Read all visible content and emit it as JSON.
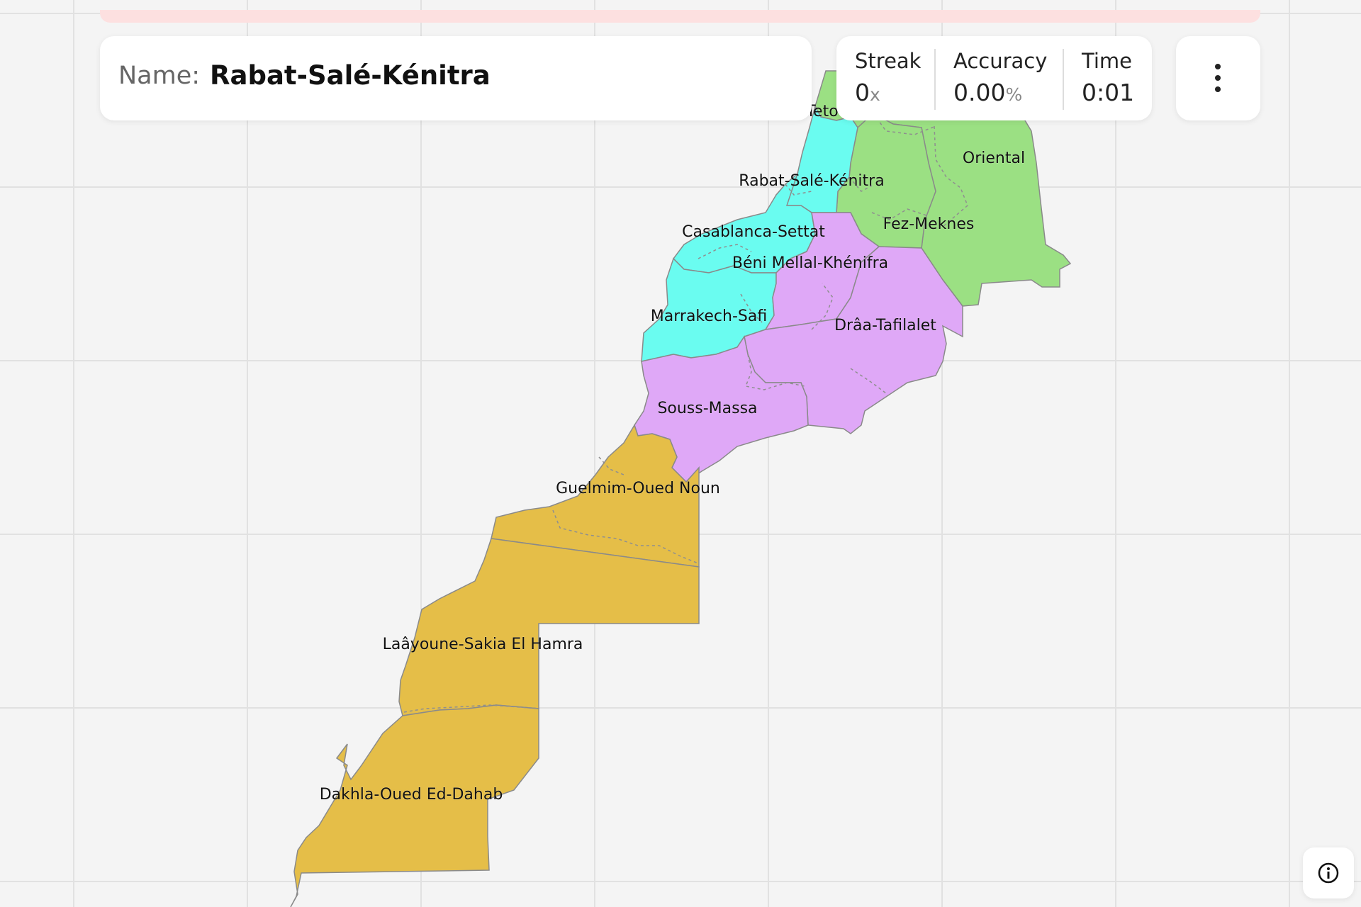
{
  "game": {
    "prompt_label": "Name:",
    "prompt_value": "Rabat-Salé-Kénitra"
  },
  "stats": {
    "streak_label": "Streak",
    "streak_value": "0",
    "streak_suffix": "x",
    "accuracy_label": "Accuracy",
    "accuracy_value": "0.00",
    "accuracy_suffix": "%",
    "time_label": "Time",
    "time_value": "0:01"
  },
  "menu": {
    "icon": "kebab-menu-icon"
  },
  "info": {
    "icon": "info-icon"
  },
  "map": {
    "country": "Morocco",
    "colors": {
      "green": "#9be083",
      "cyan": "#6afcf0",
      "violet": "#dfa8f7",
      "gold": "#e5be48"
    },
    "regions": [
      {
        "id": "tanger-tetouan",
        "label": "Teto",
        "color": "green"
      },
      {
        "id": "oriental",
        "label": "Oriental",
        "color": "green"
      },
      {
        "id": "rabat-sale-kenitra",
        "label": "Rabat-Salé-Kénitra",
        "color": "cyan"
      },
      {
        "id": "fez-meknes",
        "label": "Fez-Meknes",
        "color": "green"
      },
      {
        "id": "casablanca-settat",
        "label": "Casablanca-Settat",
        "color": "cyan"
      },
      {
        "id": "beni-mellal-khenifra",
        "label": "Béni Mellal-Khénifra",
        "color": "violet"
      },
      {
        "id": "marrakech-safi",
        "label": "Marrakech-Safi",
        "color": "cyan"
      },
      {
        "id": "draa-tafilalet",
        "label": "Drâa-Tafilalet",
        "color": "violet"
      },
      {
        "id": "souss-massa",
        "label": "Souss-Massa",
        "color": "violet"
      },
      {
        "id": "guelmim-oued-noun",
        "label": "Guelmim-Oued Noun",
        "color": "gold"
      },
      {
        "id": "laayoune-sakia-el-hamra",
        "label": "Laâyoune-Sakia El Hamra",
        "color": "gold"
      },
      {
        "id": "dakhla-oued-ed-dahab",
        "label": "Dakhla-Oued Ed-Dahab",
        "color": "gold"
      }
    ]
  }
}
